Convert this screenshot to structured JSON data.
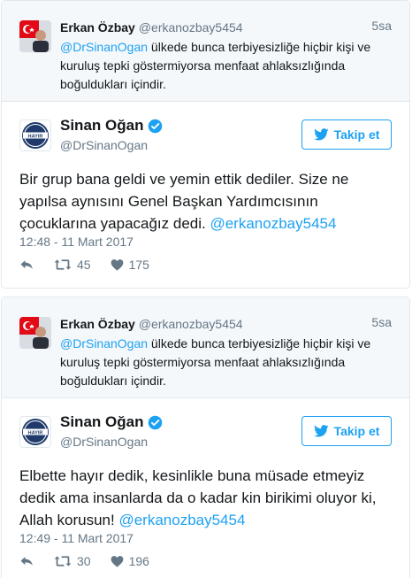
{
  "tweets": [
    {
      "parent": {
        "name": "Erkan Özbay",
        "handle": "@erkanozbay5454",
        "time": "5sa",
        "mention": "@DrSinanOgan",
        "text": " ülkede bunca terbiyesizliğe hiçbir kişi ve kuruluş tepki göstermiyorsa menfaat ahlaksızlığında boğuldukları içindir."
      },
      "main": {
        "name": "Sinan Oğan",
        "handle": "@DrSinanOgan",
        "follow_label": "Takip et",
        "avatar_label": "HAYIR",
        "text": "Bir grup bana geldi ve yemin ettik dediler. Size ne yapılsa aynısını Genel Başkan Yardımcısının çocuklarına yapacağız dedi. ",
        "mention": "@erkanozbay5454",
        "date": "12:48 - 11 Mart 2017",
        "retweets": "45",
        "likes": "175"
      }
    },
    {
      "parent": {
        "name": "Erkan Özbay",
        "handle": "@erkanozbay5454",
        "time": "5sa",
        "mention": "@DrSinanOgan",
        "text": " ülkede bunca terbiyesizliğe hiçbir kişi ve kuruluş tepki göstermiyorsa menfaat ahlaksızlığında boğuldukları içindir."
      },
      "main": {
        "name": "Sinan Oğan",
        "handle": "@DrSinanOgan",
        "follow_label": "Takip et",
        "avatar_label": "HAYIR",
        "text": "Elbette hayır dedik, kesinlikle buna müsade etmeyiz dedik ama insanlarda da o kadar kin birikimi oluyor ki, Allah korusun! ",
        "mention": "@erkanozbay5454",
        "date": "12:49 - 11 Mart 2017",
        "retweets": "30",
        "likes": "196"
      }
    }
  ],
  "icons": {
    "verified": "verified-badge-icon",
    "follow_bird": "twitter-bird-icon",
    "reply": "reply-icon",
    "retweet": "retweet-icon",
    "like": "heart-icon"
  },
  "colors": {
    "accent": "#1da1f2",
    "muted": "#657786",
    "border": "#e1e8ed",
    "parent_bg": "#f5f8fa"
  }
}
